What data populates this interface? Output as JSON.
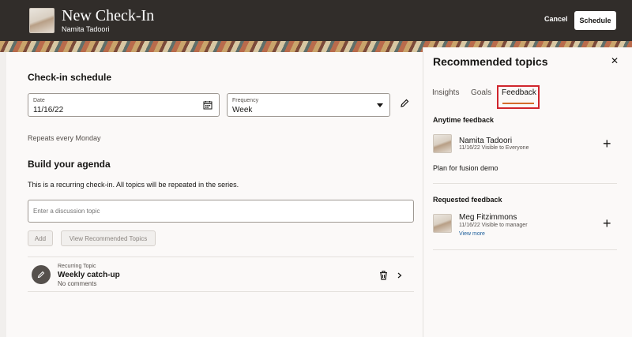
{
  "header": {
    "title": "New Check-In",
    "subtitle": "Namita Tadoori",
    "cancel_label": "Cancel",
    "schedule_label": "Schedule"
  },
  "schedule": {
    "heading": "Check-in schedule",
    "date_label": "Date",
    "date_value": "11/16/22",
    "frequency_label": "Frequency",
    "frequency_value": "Week",
    "repeats": "Repeats every Monday"
  },
  "agenda": {
    "heading": "Build your agenda",
    "note": "This is a recurring check-in. All topics will be repeated in the series.",
    "topic_placeholder": "Enter a discussion topic",
    "add_label": "Add",
    "view_recommended_label": "View Recommended Topics",
    "topic": {
      "kind": "Recurring Topic",
      "title": "Weekly catch-up",
      "comments": "No comments"
    }
  },
  "panel": {
    "title": "Recommended topics",
    "tabs": [
      "Insights",
      "Goals",
      "Feedback"
    ],
    "active_tab": "Feedback",
    "anytime_heading": "Anytime feedback",
    "anytime": {
      "name": "Namita Tadoori",
      "meta": "11/16/22 Visible to Everyone",
      "text": "Plan for fusion demo"
    },
    "requested_heading": "Requested feedback",
    "requested": {
      "name": "Meg Fitzimmons",
      "meta": "11/16/22 Visible to manager",
      "link": "View more"
    }
  },
  "colors": {
    "header_bg": "#312d2a",
    "accent": "#d46b2b",
    "highlight": "#d0262d",
    "link": "#1a5d9a"
  }
}
